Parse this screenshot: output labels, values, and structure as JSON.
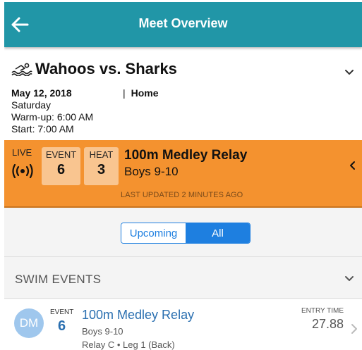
{
  "header": {
    "title": "Meet Overview",
    "back_icon": "arrow-left-icon"
  },
  "meet": {
    "icon": "swimmer-icon",
    "name": "Wahoos vs. Sharks",
    "date": "May 12, 2018",
    "day": "Saturday",
    "warmup": "Warm-up: 6:00 AM",
    "start": "Start: 7:00 AM",
    "separator": "|",
    "location": "Home"
  },
  "live": {
    "label": "LIVE",
    "icon": "broadcast-icon",
    "event_label": "EVENT",
    "event_number": "6",
    "heat_label": "HEAT",
    "heat_number": "3",
    "event_name": "100m Medley Relay",
    "event_group": "Boys 9-10",
    "updated": "LAST UPDATED 2 MINUTES AGO"
  },
  "toggle": {
    "options": [
      "Upcoming",
      "All"
    ],
    "selected": "All"
  },
  "section": {
    "title": "SWIM EVENTS"
  },
  "event_row": {
    "avatar": "DM",
    "event_label": "EVENT",
    "event_number": "6",
    "name": "100m Medley Relay",
    "group": "Boys 9-10",
    "leg": "Relay C • Leg 1 (Back)",
    "entry_label": "ENTRY TIME",
    "entry_time": "27.88"
  },
  "colors": {
    "header": "#2196a7",
    "live_bar": "#f4922f",
    "accent_blue": "#1e7fe0",
    "link_blue": "#2a6fb0"
  }
}
